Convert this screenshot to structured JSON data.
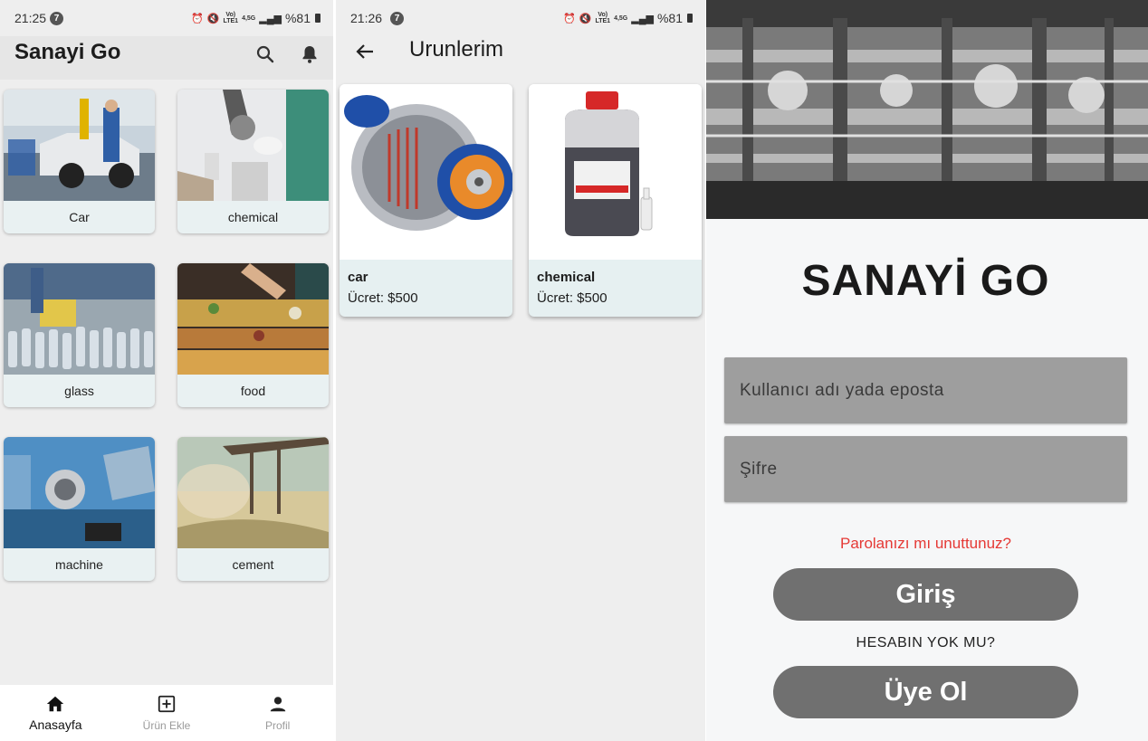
{
  "screen_home": {
    "status": {
      "time": "21:25",
      "badge": "7",
      "net_top": "Vo)",
      "net_bottom": "LTE1",
      "net_speed": "4,5G",
      "battery": "%81"
    },
    "app_title": "Sanayi Go",
    "categories": [
      {
        "label": "Car"
      },
      {
        "label": "chemical"
      },
      {
        "label": "glass"
      },
      {
        "label": "food"
      },
      {
        "label": "machine"
      },
      {
        "label": "cement"
      }
    ],
    "bottom_nav": [
      {
        "label": "Anasayfa",
        "icon": "home-icon",
        "active": true
      },
      {
        "label": "Ürün Ekle",
        "icon": "add-box-icon",
        "active": false
      },
      {
        "label": "Profil",
        "icon": "person-icon",
        "active": false
      }
    ]
  },
  "screen_products": {
    "status": {
      "time": "21:26",
      "badge": "7",
      "net_top": "Vo)",
      "net_bottom": "LTE1",
      "net_speed": "4,5G",
      "battery": "%81"
    },
    "title": "Urunlerim",
    "products": [
      {
        "name": "car",
        "price": "Ücret: $500"
      },
      {
        "name": "chemical",
        "price": "Ücret: $500"
      }
    ]
  },
  "screen_login": {
    "brand": "SANAYİ GO",
    "username_placeholder": "Kullanıcı adı yada eposta",
    "password_placeholder": "Şifre",
    "forgot_password": "Parolanızı mı unuttunuz?",
    "login_button": "Giriş",
    "no_account": "HESABIN YOK MU?",
    "register_button": "Üye Ol"
  },
  "colors": {
    "accent_red": "#e53935",
    "button_gray": "#707070",
    "field_gray": "#9e9e9e",
    "card_tint": "#e9f1f2"
  }
}
